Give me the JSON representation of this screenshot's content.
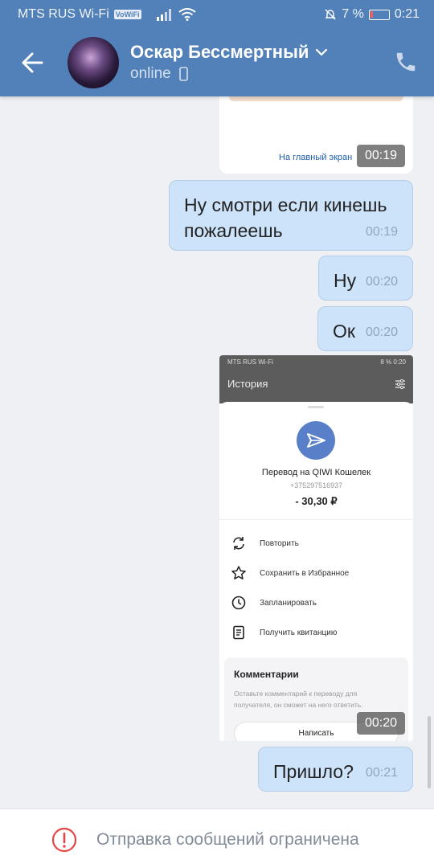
{
  "status_bar": {
    "carrier": "MTS RUS Wi-Fi",
    "volte": "VoWiFi",
    "battery": "7 %",
    "time": "0:21"
  },
  "header": {
    "contact_name": "Оскар Бессмертный",
    "status": "online"
  },
  "prev_card": {
    "link": "На главный экран",
    "time": "00:19"
  },
  "messages": [
    {
      "line1": "Ну смотри если кинешь",
      "line2": "пожалеешь",
      "time": "00:19"
    },
    {
      "text": "Ну",
      "time": "00:20"
    },
    {
      "text": "Ок",
      "time": "00:20"
    }
  ],
  "screenshot": {
    "status_left": "MTS RUS Wi-Fi",
    "status_right": "8 %  0:20",
    "title": "История",
    "transfer_title": "Перевод на QIWI Кошелек",
    "phone": "+375297516937",
    "amount": "- 30,30 ₽",
    "actions": [
      "Повторить",
      "Сохранить в Избранное",
      "Запланировать",
      "Получить квитанцию"
    ],
    "comments_title": "Комментарии",
    "comments_hint": "Оставьте комментарий к переводу для получателя, он сможет на него ответить.",
    "write_button": "Написать",
    "time": "00:20"
  },
  "last_message": {
    "text": "Пришло?",
    "time": "00:21"
  },
  "bottom": {
    "restricted": "Отправка сообщений ограничена"
  },
  "colors": {
    "header": "#5181b8",
    "bubble": "#cce3fa",
    "background": "#eef0f3",
    "alert": "#e64646"
  }
}
